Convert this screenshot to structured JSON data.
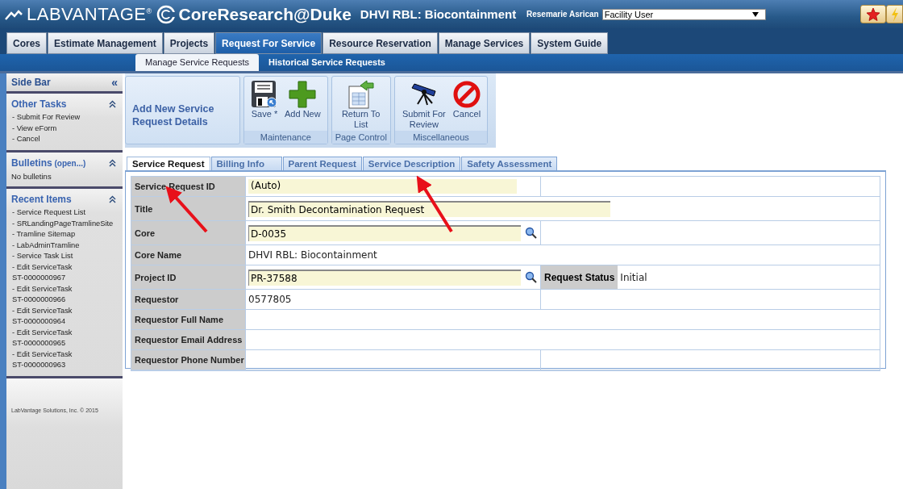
{
  "header": {
    "logo": "LABVANTAGE",
    "logo_mark": "®",
    "app_name": "CoreResearch@Duke",
    "core": "DHVI RBL: Biocontainment",
    "user": "Resemarie Asrican",
    "role": "Facility User"
  },
  "nav_tabs": [
    {
      "label": "Cores",
      "selected": false
    },
    {
      "label": "Estimate Management",
      "selected": false
    },
    {
      "label": "Projects",
      "selected": false
    },
    {
      "label": "Request For Service",
      "selected": true
    },
    {
      "label": "Resource Reservation",
      "selected": false
    },
    {
      "label": "Manage Services",
      "selected": false
    },
    {
      "label": "System Guide",
      "selected": false
    }
  ],
  "sub_tabs": [
    {
      "label": "Manage Service Requests",
      "selected": true
    },
    {
      "label": "Historical Service Requests",
      "selected": false
    }
  ],
  "sidebar": {
    "title": "Side Bar",
    "collapse": "«",
    "sections": [
      {
        "title": "Other Tasks",
        "items": [
          "- Submit For Review",
          "- View eForm",
          "- Cancel"
        ],
        "kind": "links"
      },
      {
        "title": "Bulletins",
        "title_note": "(open...)",
        "items": [
          "No bulletins"
        ],
        "kind": "text"
      },
      {
        "title": "Recent Items",
        "items": [
          "- Service Request List",
          "- SRLandingPageTramlineSite",
          "- Tramline Sitemap",
          "- LabAdminTramline",
          "- Service Task List",
          "- Edit ServiceTask ST-0000000967",
          "- Edit ServiceTask ST-0000000966",
          "- Edit ServiceTask ST-0000000964",
          "- Edit ServiceTask ST-0000000965",
          "- Edit ServiceTask ST-0000000963"
        ],
        "kind": "links"
      }
    ],
    "footer": "LabVantage Solutions, Inc. © 2015"
  },
  "toolbar": {
    "heading": "Add New Service Request Details",
    "groups": [
      {
        "label": "Maintenance",
        "buttons": [
          {
            "label": "Save *",
            "kind": "save"
          },
          {
            "label": "Add New",
            "kind": "add"
          }
        ]
      },
      {
        "label": "Page Control",
        "buttons": [
          {
            "label": "Return To List",
            "kind": "return"
          }
        ]
      },
      {
        "label": "Miscellaneous",
        "buttons": [
          {
            "label": "Submit For Review",
            "kind": "submit"
          },
          {
            "label": "Cancel",
            "kind": "cancel"
          }
        ]
      }
    ]
  },
  "form_tabs": [
    {
      "label": "Service Request",
      "selected": true
    },
    {
      "label": "Billing Info",
      "selected": false
    },
    {
      "label": "Parent Request",
      "selected": false
    },
    {
      "label": "Service Description",
      "selected": false
    },
    {
      "label": "Safety Assessment",
      "selected": false
    }
  ],
  "form_rows": [
    {
      "label": "Service Request ID",
      "value": "(Auto)",
      "kind": "readonly",
      "split": true
    },
    {
      "label": "Title",
      "value": "Dr. Smith Decontamination Request",
      "kind": "wide-input",
      "split": false
    },
    {
      "label": "Core",
      "value": "D-0035",
      "kind": "lookup",
      "split": true
    },
    {
      "label": "Core Name",
      "value": "DHVI RBL: Biocontainment",
      "kind": "text",
      "split": false
    },
    {
      "label": "Project ID",
      "value": "PR-37588",
      "kind": "lookup",
      "split": true,
      "side_label": "Request Status",
      "side_value": "Initial"
    },
    {
      "label": "Requestor",
      "value": "0577805",
      "kind": "text",
      "split": true
    },
    {
      "label": "Requestor Full Name",
      "kind": "text",
      "split": false
    },
    {
      "label": "Requestor Email Address",
      "kind": "text",
      "split": false
    },
    {
      "label": "Requestor Phone Number",
      "kind": "text",
      "split": true
    }
  ]
}
